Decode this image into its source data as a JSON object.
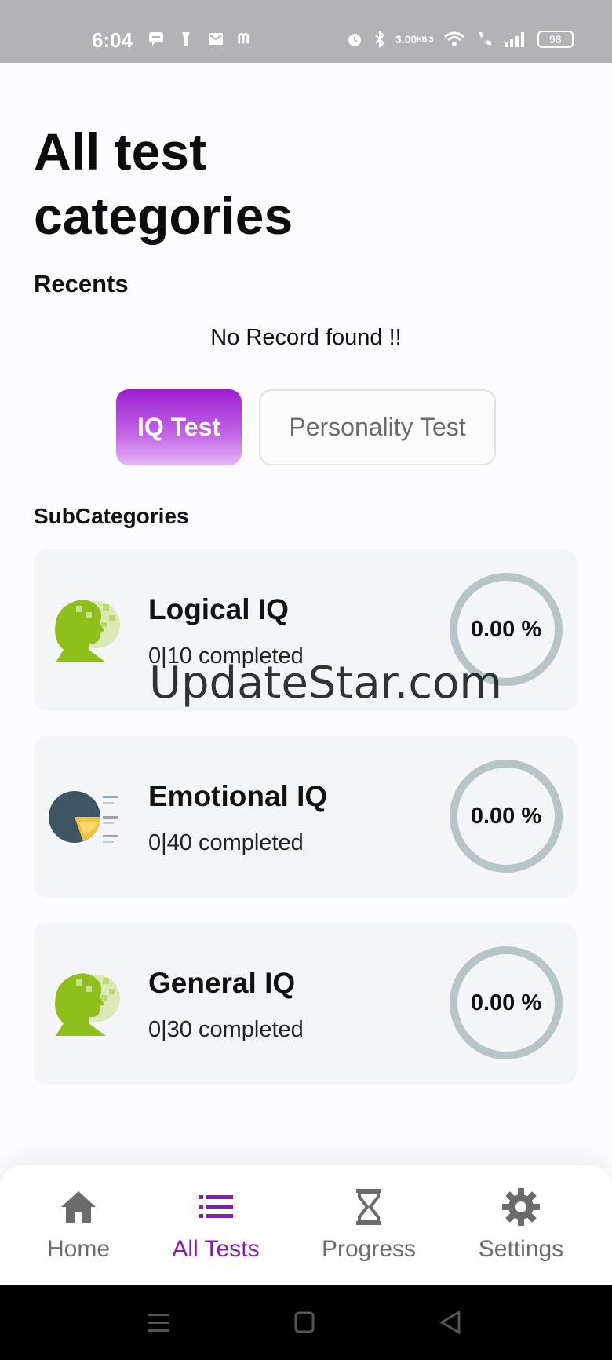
{
  "status_bar": {
    "time": "6:04",
    "net_speed_value": "3.00",
    "net_speed_unit": "KB/S",
    "battery": "98",
    "icons": [
      "chat-icon",
      "torch-icon",
      "mail-icon",
      "m-app-icon",
      "alarm-icon",
      "bluetooth-icon",
      "wifi-icon",
      "call-icon",
      "signal-icon",
      "battery-icon"
    ]
  },
  "header": {
    "title": "All test categories",
    "recents_label": "Recents",
    "no_record": "No Record found !!"
  },
  "segments": {
    "iq_label": "IQ Test",
    "personality_label": "Personality Test",
    "selected": "IQ Test"
  },
  "subcategories": {
    "heading": "SubCategories",
    "items": [
      {
        "name": "Logical IQ",
        "progress": "0|10 completed",
        "percent": "0.00 %",
        "icon": "head-puzzle-icon"
      },
      {
        "name": "Emotional IQ",
        "progress": "0|40 completed",
        "percent": "0.00 %",
        "icon": "pie-chart-icon"
      },
      {
        "name": "General IQ",
        "progress": "0|30 completed",
        "percent": "0.00 %",
        "icon": "head-puzzle-icon"
      }
    ]
  },
  "watermark": "UpdateStar.com",
  "bottom_nav": {
    "items": [
      {
        "label": "Home",
        "icon": "home-icon"
      },
      {
        "label": "All Tests",
        "icon": "list-icon"
      },
      {
        "label": "Progress",
        "icon": "hourglass-icon"
      },
      {
        "label": "Settings",
        "icon": "gear-icon"
      }
    ],
    "active": "All Tests"
  },
  "colors": {
    "accent": "#8a1ab8",
    "ring": "#b7c5c9",
    "card_bg": "#f4f5f7"
  }
}
